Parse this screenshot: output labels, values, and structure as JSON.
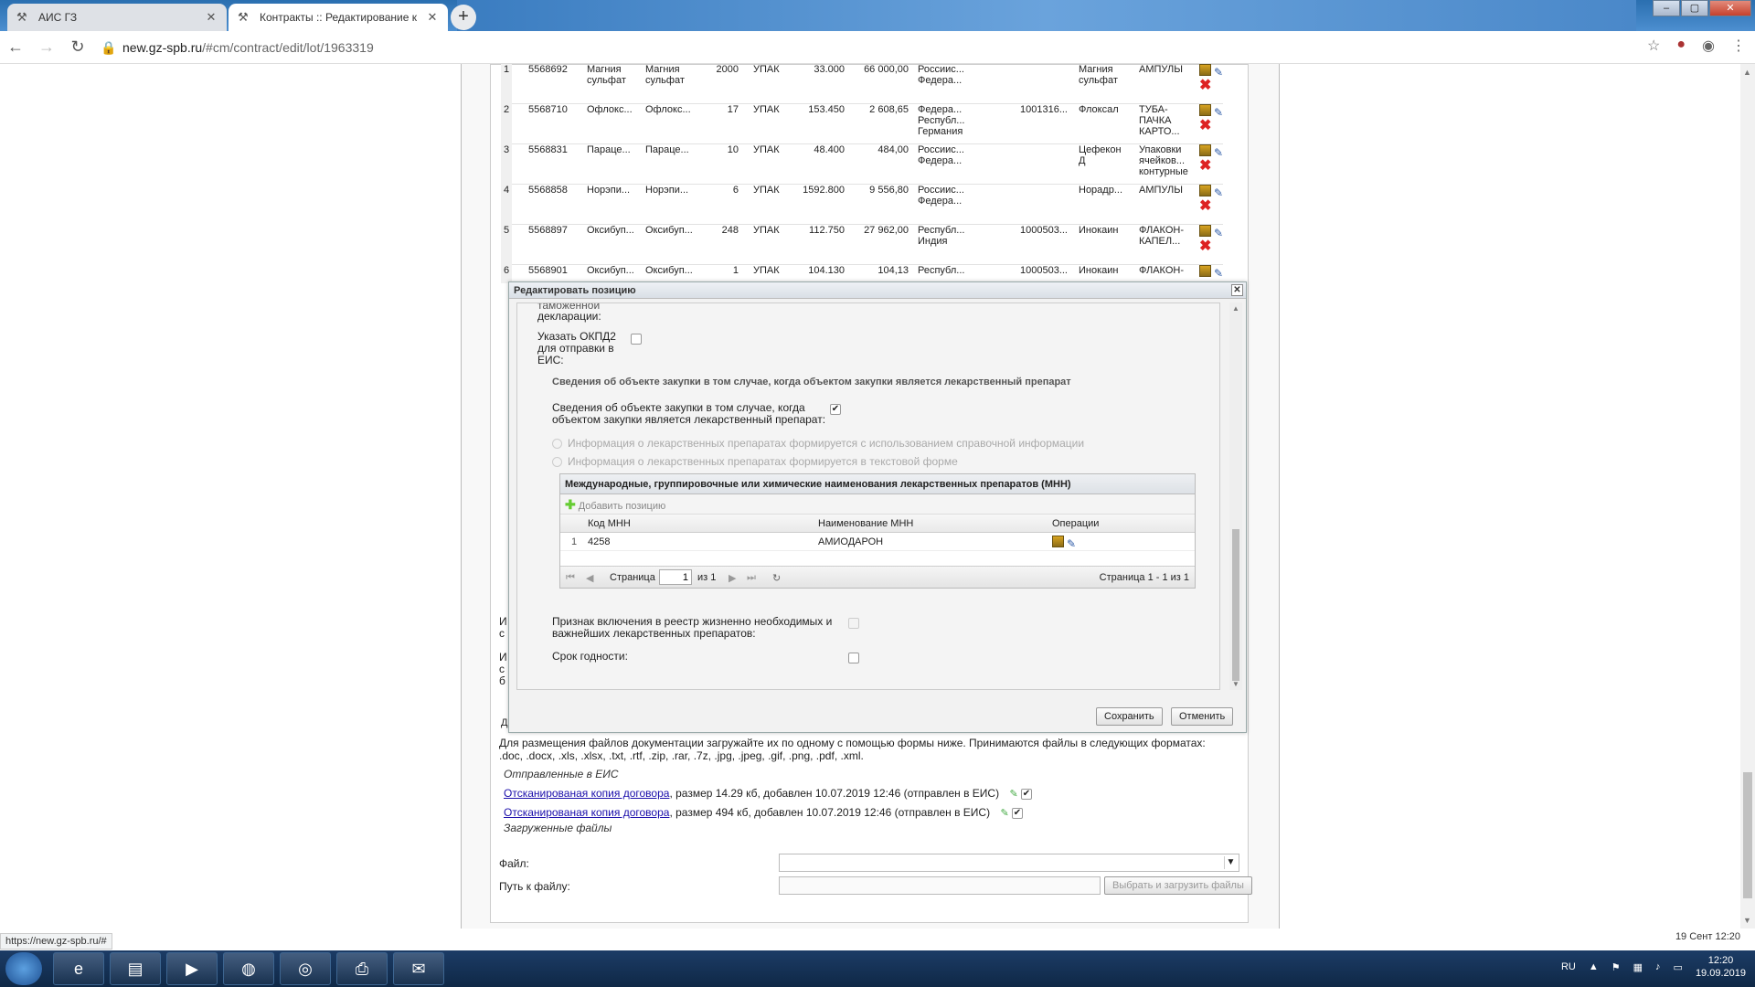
{
  "browser": {
    "tabs": [
      {
        "title": "АИС ГЗ",
        "active": false
      },
      {
        "title": "Контракты :: Редактирование к",
        "active": true
      }
    ],
    "new_tab": "+",
    "url_host": "new.gz-spb.ru",
    "url_path": "/#cm/contract/edit/lot/1963319"
  },
  "grid": {
    "rows": [
      {
        "n": "1",
        "id": "5568692",
        "name1": "Магния сульфат",
        "name2": "Магния сульфат",
        "qty": "2000",
        "unit": "УПАК",
        "price": "33.000",
        "sum": "66 000,00",
        "country": "Россиис... Федера...",
        "code": "",
        "trade": "Магния сульфат",
        "pack": "АМПУЛЫ"
      },
      {
        "n": "2",
        "id": "5568710",
        "name1": "Офлокс...",
        "name2": "Офлокс...",
        "qty": "17",
        "unit": "УПАК",
        "price": "153.450",
        "sum": "2 608,65",
        "country": "Федера... Республ... Германия",
        "code": "1001316...",
        "trade": "Флоксал",
        "pack": "ТУБА-ПАЧКА КАРТО..."
      },
      {
        "n": "3",
        "id": "5568831",
        "name1": "Параце...",
        "name2": "Параце...",
        "qty": "10",
        "unit": "УПАК",
        "price": "48.400",
        "sum": "484,00",
        "country": "Россиис... Федера...",
        "code": "",
        "trade": "Цефекон Д",
        "pack": "Упаковки ячейков... контурные"
      },
      {
        "n": "4",
        "id": "5568858",
        "name1": "Норэпи...",
        "name2": "Норэпи...",
        "qty": "6",
        "unit": "УПАК",
        "price": "1592.800",
        "sum": "9 556,80",
        "country": "Россиис... Федера...",
        "code": "",
        "trade": "Норадр...",
        "pack": "АМПУЛЫ"
      },
      {
        "n": "5",
        "id": "5568897",
        "name1": "Оксибуп...",
        "name2": "Оксибуп...",
        "qty": "248",
        "unit": "УПАК",
        "price": "112.750",
        "sum": "27 962,00",
        "country": "Республ... Индия",
        "code": "1000503...",
        "trade": "Инокаин",
        "pack": "ФЛАКОН-КАПЕЛ..."
      },
      {
        "n": "6",
        "id": "5568901",
        "name1": "Оксибуп...",
        "name2": "Оксибуп...",
        "qty": "1",
        "unit": "УПАК",
        "price": "104.130",
        "sum": "104,13",
        "country": "Республ...",
        "code": "1000503...",
        "trade": "Инокаин",
        "pack": "ФЛАКОН-"
      }
    ]
  },
  "dialog": {
    "title": "Редактировать позицию",
    "cut_label_1": "таможенной",
    "cut_label_2": "декларации:",
    "okpd_label": "Указать ОКПД2 для отправки в ЕИС:",
    "section_title": "Сведения об объекте закупки в том случае, когда объектом закупки является лекарственный препарат",
    "drug_label": "Сведения об объекте закупки в том случае, когда объектом закупки является лекарственный препарат:",
    "radio1": "Информация о лекарственных препаратах формируется с использованием справочной информации",
    "radio2": "Информация о лекарственных препаратах формируется в текстовой форме",
    "mnn": {
      "header": "Международные, группировочные или химические наименования лекарственных препаратов (МНН)",
      "add": "Добавить позицию",
      "col_code": "Код МНН",
      "col_name": "Наименование МНН",
      "col_ops": "Операции",
      "rows": [
        {
          "n": "1",
          "code": "4258",
          "name": "АМИОДАРОН"
        }
      ],
      "pager_page": "Страница",
      "pager_value": "1",
      "pager_of": "из 1",
      "pager_info": "Страница 1 - 1 из 1"
    },
    "vital_label": "Признак включения в реестр жизненно необходимых и важнейших лекарственных препаратов:",
    "expiry_label": "Срок годности:",
    "save": "Сохранить",
    "cancel": "Отменить"
  },
  "behind_fragments": [
    "И",
    "с",
    "И",
    "с",
    "б",
    "Д"
  ],
  "docs": {
    "info": "Для размещения файлов документации загружайте их по одному с помощью формы ниже. Принимаются файлы в следующих форматах: .doc, .docx, .xls, .xlsx, .txt, .rtf, .zip, .rar, .7z, .jpg, .jpeg, .gif, .png, .pdf, .xml.",
    "sent_title": "Отправленные в ЕИС",
    "files": [
      {
        "link": "Отсканированая копия договора",
        "meta": ", размер 14.29 кб, добавлен 10.07.2019 12:46 (отправлен в ЕИС)"
      },
      {
        "link": "Отсканированая копия договора",
        "meta": ", размер 494 кб, добавлен 10.07.2019 12:46 (отправлен в ЕИС)"
      }
    ],
    "loaded_title": "Загруженные файлы",
    "file_label": "Файл:",
    "path_label": "Путь к файлу:",
    "upload_btn": "Выбрать и загрузить файлы"
  },
  "status": {
    "url": "https://new.gz-spb.ru/#",
    "date": "19 Сент 12:20"
  },
  "taskbar": {
    "lang": "RU",
    "time": "12:20",
    "date": "19.09.2019"
  }
}
